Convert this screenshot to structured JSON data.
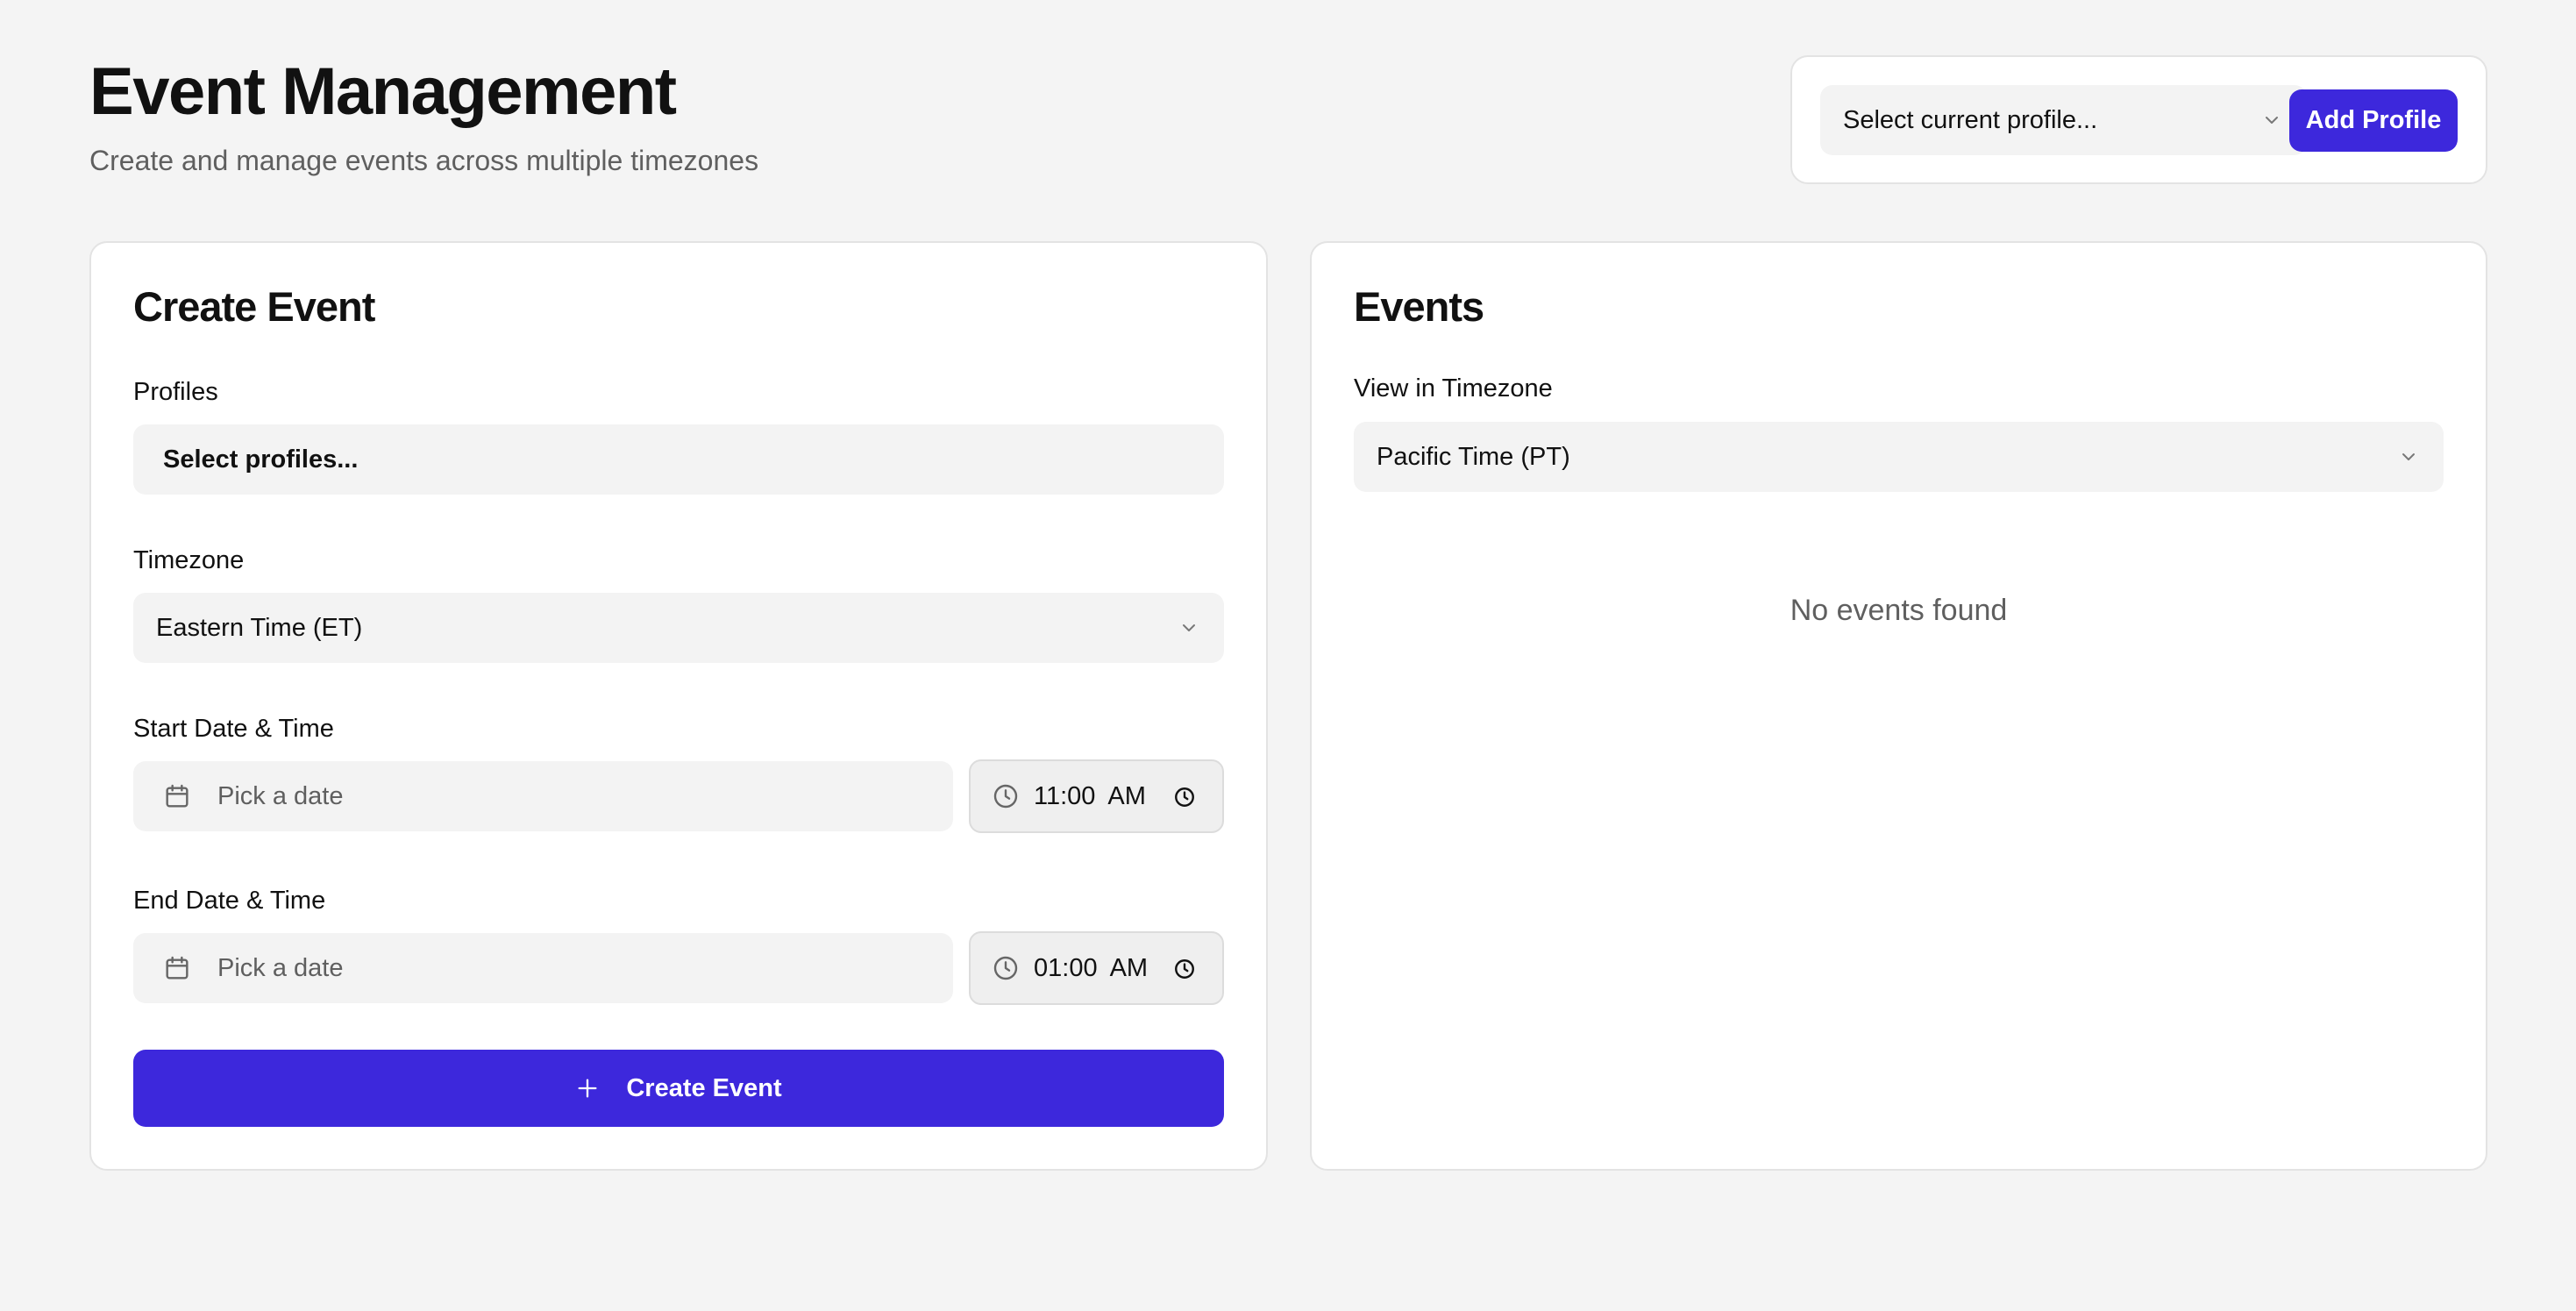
{
  "header": {
    "title": "Event Management",
    "subtitle": "Create and manage events across multiple timezones"
  },
  "profile_bar": {
    "select_placeholder": "Select current profile...",
    "add_profile_label": "Add Profile"
  },
  "create_event": {
    "title": "Create Event",
    "profiles_label": "Profiles",
    "profiles_placeholder": "Select profiles...",
    "timezone_label": "Timezone",
    "timezone_value": "Eastern Time (ET)",
    "start_label": "Start Date & Time",
    "start_date_placeholder": "Pick a date",
    "start_time": "11:00",
    "start_ampm": "AM",
    "end_label": "End Date & Time",
    "end_date_placeholder": "Pick a date",
    "end_time": "01:00",
    "end_ampm": "AM",
    "submit_label": "Create Event"
  },
  "events": {
    "title": "Events",
    "view_tz_label": "View in Timezone",
    "view_tz_value": "Pacific Time (PT)",
    "empty_message": "No events found"
  },
  "icons": {
    "dropdown": "chevron-down-icon",
    "date": "calendar-icon",
    "time": "clock-icon",
    "add": "plus-icon"
  },
  "colors": {
    "accent": "#3d28dc",
    "background": "#f4f4f4",
    "card": "#ffffff",
    "field": "#f3f3f3"
  }
}
